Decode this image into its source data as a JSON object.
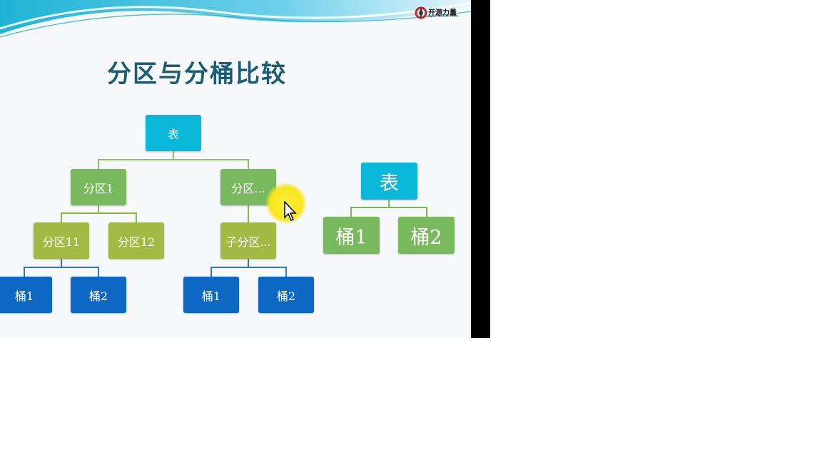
{
  "slide": {
    "title": "分区与分桶比较",
    "logo": {
      "name": "开源力量",
      "sub": "Open Source Force"
    }
  },
  "tree_left": {
    "root": "表",
    "partition1": "分区1",
    "partition2": "分区...",
    "partition11": "分区11",
    "partition12": "分区12",
    "subpartition": "子分区...",
    "p11_bucket1": "桶1",
    "p11_bucket2": "桶2",
    "sub_bucket1": "桶1",
    "sub_bucket2": "桶2"
  },
  "tree_right": {
    "root": "表",
    "bucket1": "桶1",
    "bucket2": "桶2"
  },
  "colors": {
    "root": "#0cb8d9",
    "partition": "#77b95c",
    "subpartition": "#a2b943",
    "bucket": "#0c68c2",
    "title": "#1d5d73"
  }
}
